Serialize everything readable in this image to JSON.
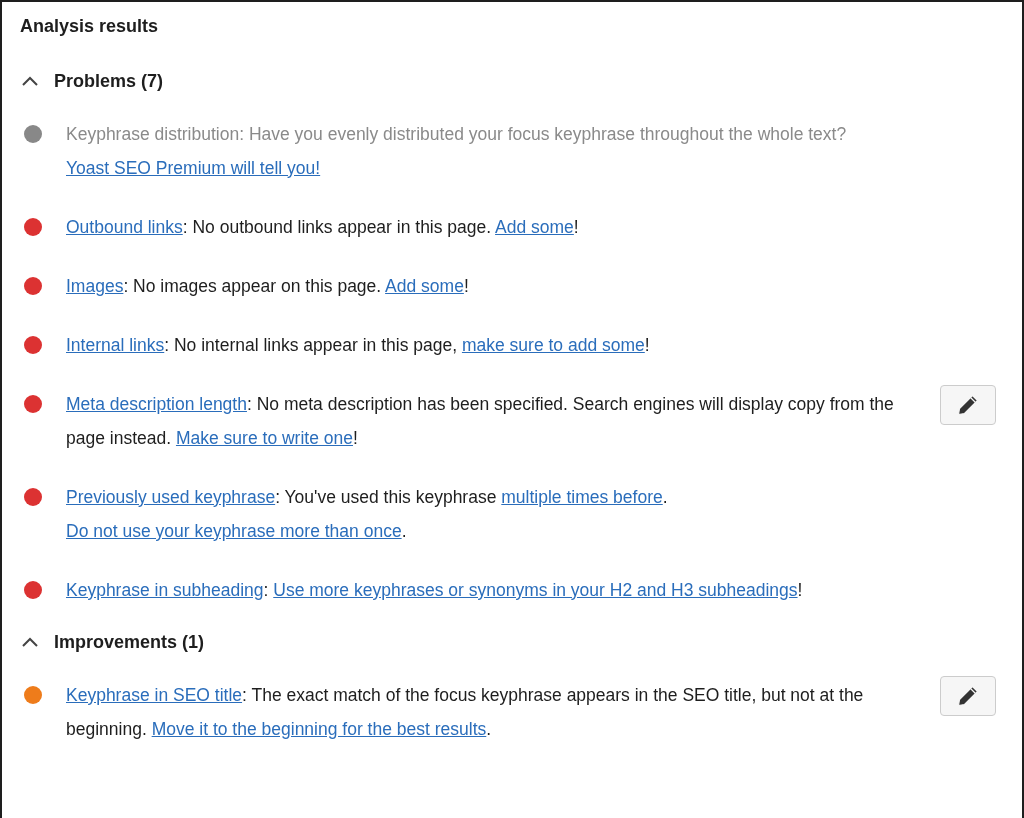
{
  "title": "Analysis results",
  "sections": [
    {
      "title": "Problems (7)",
      "expanded": true,
      "items": [
        {
          "color": "#888888",
          "disabled": true,
          "edit_button": false,
          "parts": [
            {
              "kind": "text",
              "text": "Keyphrase distribution: Have you evenly distributed your focus keyphrase throughout the whole text? "
            },
            {
              "kind": "link",
              "text": "Yoast SEO Premium will tell you!"
            }
          ]
        },
        {
          "color": "#dc3232",
          "disabled": false,
          "edit_button": false,
          "parts": [
            {
              "kind": "link",
              "text": "Outbound links"
            },
            {
              "kind": "text",
              "text": ": No outbound links appear in this page. "
            },
            {
              "kind": "link",
              "text": "Add some"
            },
            {
              "kind": "text",
              "text": "!"
            }
          ]
        },
        {
          "color": "#dc3232",
          "disabled": false,
          "edit_button": false,
          "parts": [
            {
              "kind": "link",
              "text": "Images"
            },
            {
              "kind": "text",
              "text": ": No images appear on this page. "
            },
            {
              "kind": "link",
              "text": "Add some"
            },
            {
              "kind": "text",
              "text": "!"
            }
          ]
        },
        {
          "color": "#dc3232",
          "disabled": false,
          "edit_button": false,
          "parts": [
            {
              "kind": "link",
              "text": "Internal links"
            },
            {
              "kind": "text",
              "text": ": No internal links appear in this page, "
            },
            {
              "kind": "link",
              "text": "make sure to add some"
            },
            {
              "kind": "text",
              "text": "!"
            }
          ]
        },
        {
          "color": "#dc3232",
          "disabled": false,
          "edit_button": true,
          "parts": [
            {
              "kind": "link",
              "text": "Meta description length"
            },
            {
              "kind": "text",
              "text": ": No meta description has been specified. Search engines will display copy from the page instead. "
            },
            {
              "kind": "link",
              "text": "Make sure to write one"
            },
            {
              "kind": "text",
              "text": "!"
            }
          ]
        },
        {
          "color": "#dc3232",
          "disabled": false,
          "edit_button": false,
          "parts": [
            {
              "kind": "link",
              "text": "Previously used keyphrase"
            },
            {
              "kind": "text",
              "text": ": You've used this keyphrase "
            },
            {
              "kind": "link",
              "text": "multiple times before"
            },
            {
              "kind": "text",
              "text": ". "
            },
            {
              "kind": "link",
              "text": "Do not use your keyphrase more than once"
            },
            {
              "kind": "text",
              "text": "."
            }
          ]
        },
        {
          "color": "#dc3232",
          "disabled": false,
          "edit_button": false,
          "parts": [
            {
              "kind": "link",
              "text": "Keyphrase in subheading"
            },
            {
              "kind": "text",
              "text": ": "
            },
            {
              "kind": "link",
              "text": "Use more keyphrases or synonyms in your H2 and H3 subheadings"
            },
            {
              "kind": "text",
              "text": "!"
            }
          ]
        }
      ]
    },
    {
      "title": "Improvements (1)",
      "expanded": true,
      "items": [
        {
          "color": "#ee7c1b",
          "disabled": false,
          "edit_button": true,
          "parts": [
            {
              "kind": "link",
              "text": "Keyphrase in SEO title"
            },
            {
              "kind": "text",
              "text": ": The exact match of the focus keyphrase appears in the SEO title, but not at the beginning. "
            },
            {
              "kind": "link",
              "text": "Move it to the beginning for the best results"
            },
            {
              "kind": "text",
              "text": "."
            }
          ]
        }
      ]
    }
  ]
}
